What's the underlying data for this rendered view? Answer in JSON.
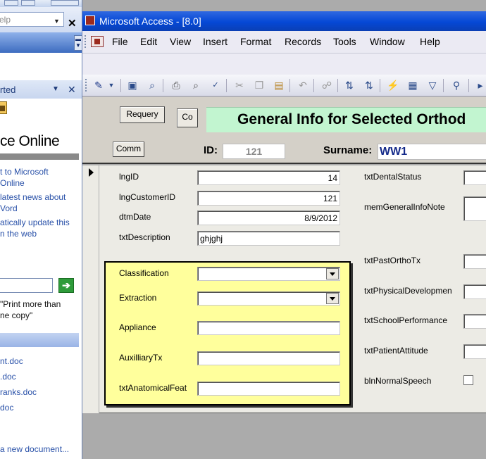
{
  "left_pane": {
    "help_placeholder": "elp",
    "panel_title": "rted",
    "office_online": "ce Online",
    "links": [
      "t to Microsoft",
      "Online",
      "latest news about",
      "Vord",
      "atically update this",
      "n the web"
    ],
    "go_arrow": "➔",
    "search_hint": [
      "\"Print more than",
      "ne copy\""
    ],
    "documents": [
      "nt.doc",
      ".doc",
      "ranks.doc",
      "doc"
    ],
    "new_document": "a new document..."
  },
  "access": {
    "title": "Microsoft Access - [8.0]",
    "menu": [
      "File",
      "Edit",
      "View",
      "Insert",
      "Format",
      "Records",
      "Tools",
      "Window",
      "Help"
    ]
  },
  "form": {
    "requery_label": "Requery",
    "co_label": "Co",
    "comm_label": "Comm",
    "banner": "General Info for Selected Orthod",
    "id_label": "ID:",
    "id_value": "121",
    "surname_label": "Surname:",
    "surname_value": "WW1",
    "fields": {
      "lngID": {
        "label": "lngID",
        "value": "14"
      },
      "lngCustomerID": {
        "label": "lngCustomerID",
        "value": "121"
      },
      "dtmDate": {
        "label": "dtmDate",
        "value": "8/9/2012"
      },
      "txtDescription": {
        "label": "txtDescription",
        "value": "ghjghj"
      },
      "Classification": {
        "label": "Classification",
        "value": ""
      },
      "Extraction": {
        "label": "Extraction",
        "value": ""
      },
      "Appliance": {
        "label": "Appliance",
        "value": ""
      },
      "AuxilliaryTx": {
        "label": "AuxilliaryTx",
        "value": ""
      },
      "txtAnatomicalFeat": {
        "label": "txtAnatomicalFeat",
        "value": ""
      },
      "txtDentalStatus": {
        "label": "txtDentalStatus",
        "value": ""
      },
      "memGeneralInfoNote": {
        "label": "memGeneralInfoNote",
        "value": ""
      },
      "txtPastOrthoTx": {
        "label": "txtPastOrthoTx",
        "value": ""
      },
      "txtPhysicalDevelopmen": {
        "label": "txtPhysicalDevelopmen",
        "value": ""
      },
      "txtSchoolPerformance": {
        "label": "txtSchoolPerformance",
        "value": ""
      },
      "txtPatientAttitude": {
        "label": "txtPatientAttitude",
        "value": ""
      },
      "blnNormalSpeech": {
        "label": "blnNormalSpeech",
        "checked": false
      }
    }
  }
}
